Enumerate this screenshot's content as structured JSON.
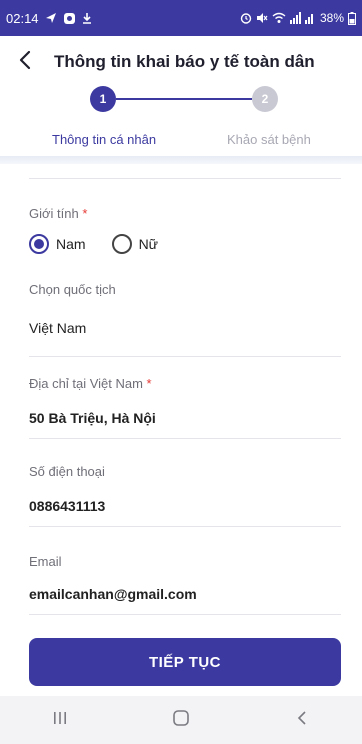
{
  "status_bar": {
    "time": "02:14",
    "battery": "38%"
  },
  "header": {
    "title": "Thông tin khai báo y tế toàn dân",
    "back_icon": "chevron-left-icon"
  },
  "stepper": {
    "steps": [
      {
        "number": "1",
        "label": "Thông tin cá nhân",
        "active": true
      },
      {
        "number": "2",
        "label": "Khảo sát bệnh",
        "active": false
      }
    ],
    "active_color": "#3c3aa0",
    "inactive_color": "#c9c9d4"
  },
  "form": {
    "gender": {
      "label": "Giới tính",
      "required_mark": "*",
      "options": [
        {
          "label": "Nam",
          "selected": true
        },
        {
          "label": "Nữ",
          "selected": false
        }
      ]
    },
    "nationality": {
      "label": "Chọn quốc tịch",
      "value": "Việt Nam"
    },
    "address": {
      "label": "Địa chỉ tại Việt Nam",
      "required_mark": "*",
      "value": "50 Bà Triệu, Hà Nội"
    },
    "phone": {
      "label": "Số điện thoại",
      "value": "0886431113"
    },
    "email": {
      "label": "Email",
      "value": "emailcanhan@gmail.com"
    }
  },
  "actions": {
    "continue_label": "TIẾP TỤC"
  },
  "colors": {
    "primary": "#3c3aa0",
    "required": "#e53935"
  }
}
